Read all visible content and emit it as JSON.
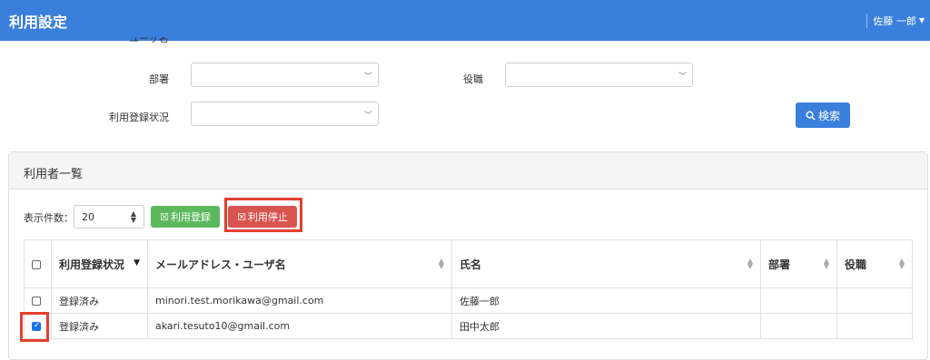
{
  "header": {
    "title": "利用設定",
    "user": "佐藤 一郎"
  },
  "filters": {
    "top_stub": "ユーザ名",
    "dept_label": "部署",
    "role_label": "役職",
    "status_label": "利用登録状況",
    "search_label": "検索"
  },
  "panel": {
    "title": "利用者一覧",
    "count_label": "表示件数：",
    "count_value": "20",
    "register_label": "利用登録",
    "suspend_label": "利用停止"
  },
  "table": {
    "headers": {
      "status": "利用登録状況",
      "email": "メールアドレス・ユーザ名",
      "name": "氏名",
      "dept": "部署",
      "role": "役職"
    },
    "rows": [
      {
        "checked": false,
        "status": "登録済み",
        "email": "minori.test.morikawa@gmail.com",
        "name": "佐藤一郎",
        "dept": "",
        "role": ""
      },
      {
        "checked": true,
        "status": "登録済み",
        "email": "akari.tesuto10@gmail.com",
        "name": "田中太郎",
        "dept": "",
        "role": ""
      }
    ]
  },
  "colors": {
    "accent": "#3a7fdc",
    "success": "#5cb85c",
    "danger": "#d9534f",
    "highlight": "#e4402c"
  }
}
